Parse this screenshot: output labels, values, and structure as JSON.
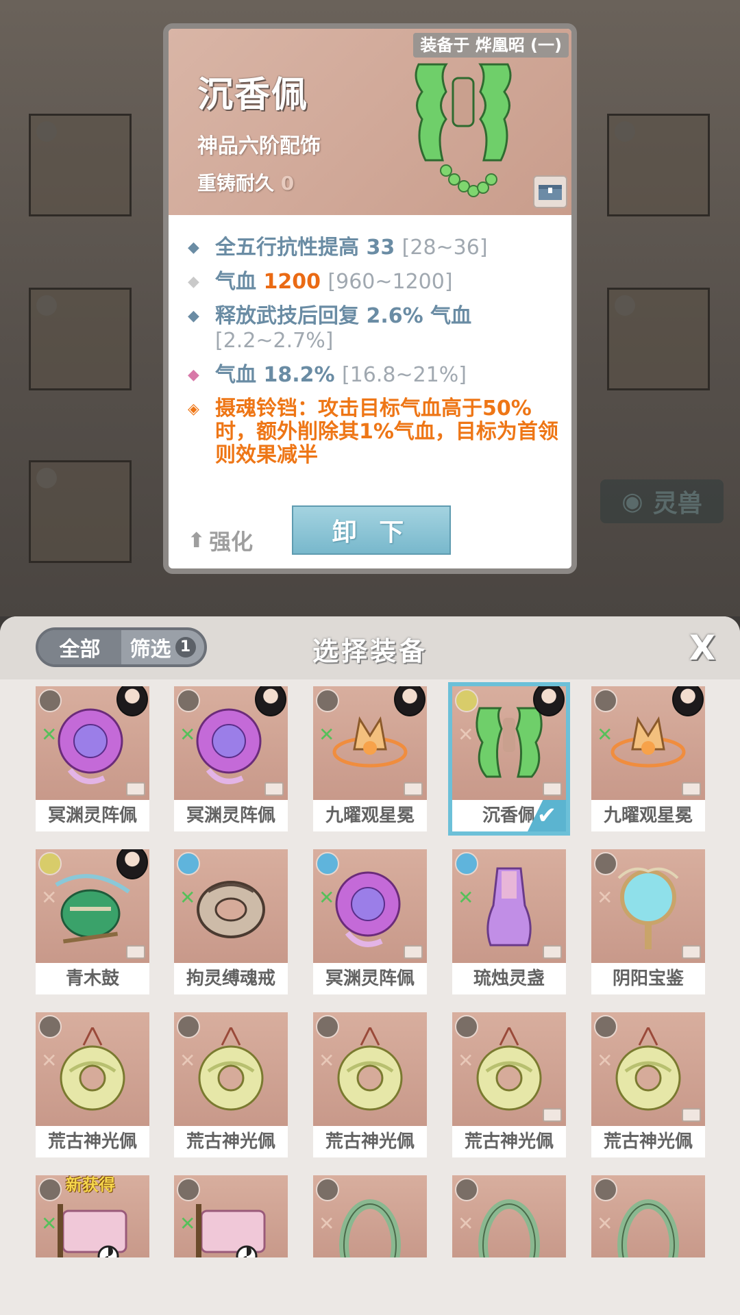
{
  "detail": {
    "equipped_on": "装备于 烨凰昭 (一)",
    "name": "沉香佩",
    "grade": "神品六阶配饰",
    "reforge_label": "重铸耐久",
    "reforge_value": "0",
    "stats": [
      {
        "bullet": "◆",
        "text": "全五行抗性提高 33",
        "range": "[28~36]"
      },
      {
        "bullet": "◆",
        "prefix": "气血 ",
        "highlight": "1200",
        "range": "[960~1200]"
      },
      {
        "bullet": "◆",
        "text": "释放武技后回复 2.6% 气血",
        "range": "[2.2~2.7%]"
      },
      {
        "bullet": "◆",
        "text": "气血 18.2%",
        "range": "[16.8~21%]"
      },
      {
        "bullet": "◈",
        "text": "摄魂铃铛：攻击目标气血高于50%时，额外削除其1%气血，目标为首领则效果减半"
      }
    ],
    "upgrade_label": "强化",
    "unload_label": "卸 下"
  },
  "background": {
    "spirit_beast_label": "灵兽"
  },
  "panel": {
    "title": "选择装备",
    "tab_all": "全部",
    "tab_filter": "筛选",
    "filter_count": "1",
    "close_label": "X"
  },
  "items": [
    {
      "name": "冥渊灵阵佩",
      "kind": "orb-pink"
    },
    {
      "name": "冥渊灵阵佩",
      "kind": "orb-pink"
    },
    {
      "name": "九曜观星冕",
      "kind": "crown"
    },
    {
      "name": "沉香佩",
      "kind": "jade",
      "selected": true
    },
    {
      "name": "九曜观星冕",
      "kind": "crown"
    },
    {
      "name": "青木鼓",
      "kind": "drum"
    },
    {
      "name": "拘灵缚魂戒",
      "kind": "ring"
    },
    {
      "name": "冥渊灵阵佩",
      "kind": "orb-pink"
    },
    {
      "name": "琉烛灵盏",
      "kind": "lamp"
    },
    {
      "name": "阴阳宝鉴",
      "kind": "mirror"
    },
    {
      "name": "荒古神光佩",
      "kind": "pendant"
    },
    {
      "name": "荒古神光佩",
      "kind": "pendant"
    },
    {
      "name": "荒古神光佩",
      "kind": "pendant"
    },
    {
      "name": "荒古神光佩",
      "kind": "pendant"
    },
    {
      "name": "荒古神光佩",
      "kind": "pendant"
    }
  ],
  "partial_items": [
    {
      "new_label": "新获得",
      "kind": "scroll"
    },
    {
      "kind": "scroll"
    },
    {
      "kind": "bangle"
    },
    {
      "kind": "bangle"
    },
    {
      "kind": "bangle"
    }
  ],
  "selected_check": "✔",
  "colors": {
    "accent_blue": "#6cc0d8",
    "highlight_orange": "#ea6a14",
    "stat_blue": "#6a8ca4",
    "effect_orange": "#ee7616"
  }
}
